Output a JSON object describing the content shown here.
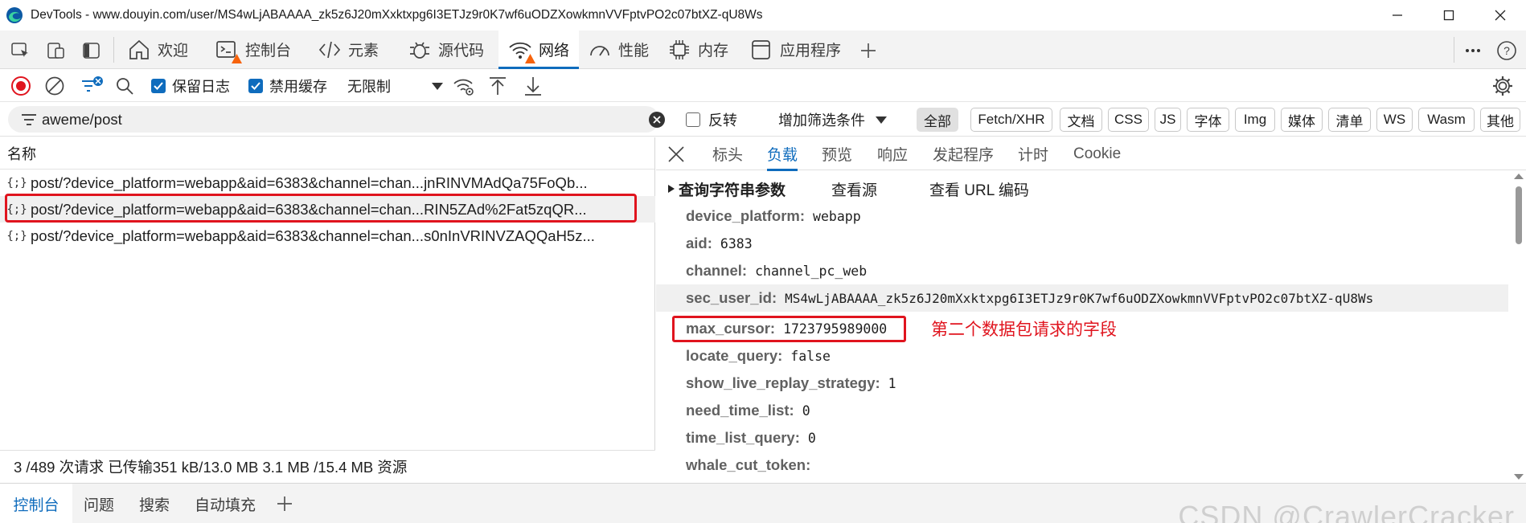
{
  "window": {
    "title": "DevTools - www.douyin.com/user/MS4wLjABAAAA_zk5z6J20mXxktxpg6I3ETJz9r0K7wf6uODZXowkmnVVFptvPO2c07btXZ-qU8Ws"
  },
  "tabs": [
    {
      "label": "欢迎",
      "icon": "home-icon"
    },
    {
      "label": "控制台",
      "icon": "console-icon"
    },
    {
      "label": "元素",
      "icon": "code-icon"
    },
    {
      "label": "源代码",
      "icon": "bug-icon"
    },
    {
      "label": "网络",
      "icon": "wifi-icon",
      "active": true
    },
    {
      "label": "性能",
      "icon": "speedometer-icon"
    },
    {
      "label": "内存",
      "icon": "chip-icon"
    },
    {
      "label": "应用程序",
      "icon": "app-window-icon"
    }
  ],
  "network_toolbar": {
    "preserve_log": {
      "label": "保留日志",
      "checked": true
    },
    "disable_cache": {
      "label": "禁用缓存",
      "checked": true
    },
    "throttling": "无限制"
  },
  "filter": {
    "value": "aweme/post",
    "invert_label": "反转",
    "add_filter_label": "增加筛选条件",
    "types": [
      "全部",
      "Fetch/XHR",
      "文档",
      "CSS",
      "JS",
      "字体",
      "Img",
      "媒体",
      "清单",
      "WS",
      "Wasm",
      "其他"
    ],
    "active_type": "全部"
  },
  "requests": {
    "header": "名称",
    "rows": [
      {
        "name": "post/?device_platform=webapp&aid=6383&channel=chan...jnRINVMAdQa75FoQb..."
      },
      {
        "name": "post/?device_platform=webapp&aid=6383&channel=chan...RIN5ZAd%2Fat5zqQR..."
      },
      {
        "name": "post/?device_platform=webapp&aid=6383&channel=chan...s0nInVRINVZAQQaH5z..."
      }
    ],
    "status": "3 /489 次请求  已传输351 kB/13.0 MB  3.1 MB /15.4 MB 资源"
  },
  "detail": {
    "tabs": [
      "标头",
      "负载",
      "预览",
      "响应",
      "发起程序",
      "计时",
      "Cookie"
    ],
    "active_tab": "负载",
    "section_title": "查询字符串参数",
    "view_source": "查看源",
    "view_url_encoded": "查看 URL 编码",
    "params": [
      {
        "key": "device_platform:",
        "value": "webapp"
      },
      {
        "key": "aid:",
        "value": "6383"
      },
      {
        "key": "channel:",
        "value": "channel_pc_web"
      },
      {
        "key": "sec_user_id:",
        "value": "MS4wLjABAAAA_zk5z6J20mXxktxpg6I3ETJz9r0K7wf6uODZXowkmnVVFptvPO2c07btXZ-qU8Ws"
      },
      {
        "key": "max_cursor:",
        "value": "1723795989000"
      },
      {
        "key": "locate_query:",
        "value": "false"
      },
      {
        "key": "show_live_replay_strategy:",
        "value": "1"
      },
      {
        "key": "need_time_list:",
        "value": "0"
      },
      {
        "key": "time_list_query:",
        "value": "0"
      },
      {
        "key": "whale_cut_token:",
        "value": ""
      }
    ],
    "annotation": "第二个数据包请求的字段"
  },
  "drawer": {
    "tabs": [
      "控制台",
      "问题",
      "搜索",
      "自动填充"
    ],
    "active_tab": "控制台"
  },
  "watermark": "CSDN @CrawlerCracker",
  "colors": {
    "accent": "#0f6cbd",
    "highlight_red": "#e0141e",
    "warning": "#f7630c"
  }
}
